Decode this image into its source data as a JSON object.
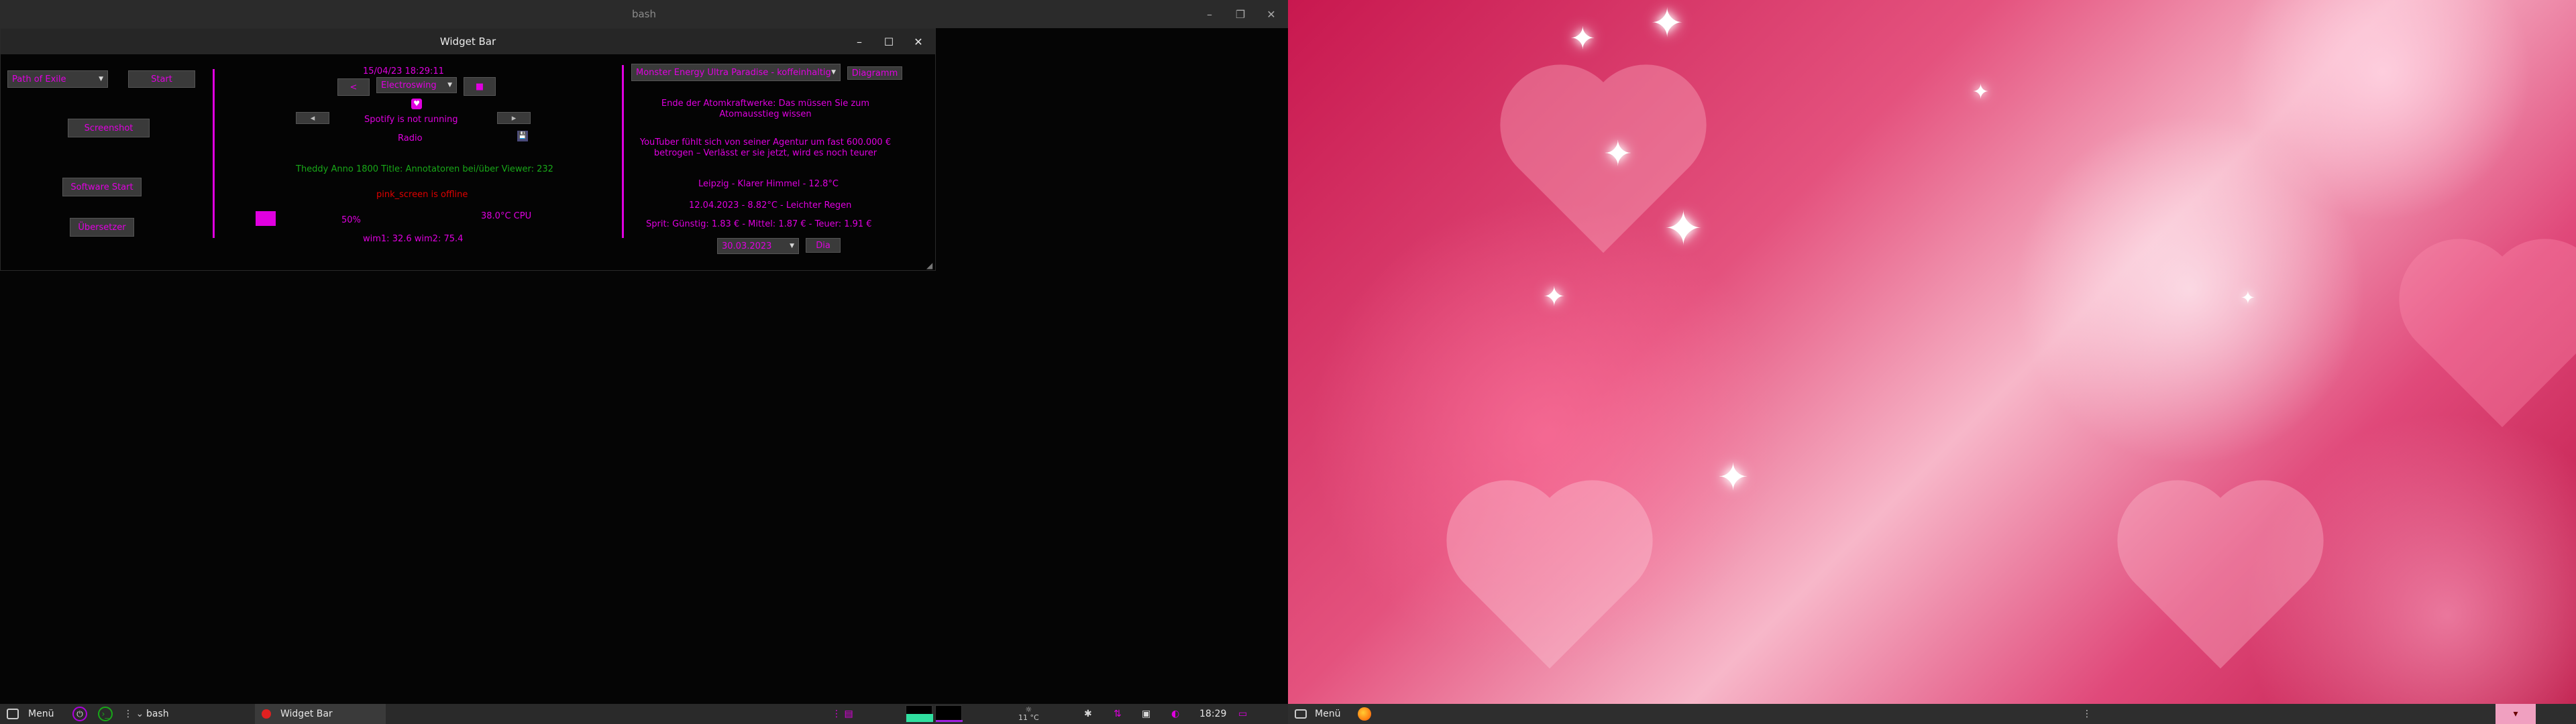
{
  "bash_window": {
    "title": "bash"
  },
  "widget": {
    "title": "Widget Bar",
    "game_select": "Path of Exile",
    "start_label": "Start",
    "screenshot_label": "Screenshot",
    "software_start_label": "Software Start",
    "uebersetzer_label": "Übersetzer",
    "datetime": "15/04/23 18:29:11",
    "prev_label": "<",
    "playlist_select": "Electroswing",
    "stop_label": "■",
    "spotify_status": "Spotify is not running",
    "radio_label": "Radio",
    "twitch_line": "Theddy Anno 1800 Title: Annotatoren bei/über Viewer: 232",
    "stream_status": "pink_screen is offline",
    "volume_percent": "50%",
    "cpu_temp": "38.0°C CPU",
    "wind_status": "wim1: 32.6 wim2: 75.4",
    "product_select": "Monster Energy Ultra Paradise - koffeinhaltig",
    "diagramm_label": "Diagramm",
    "news_1": "Ende der Atomkraftwerke: Das müssen Sie zum Atomausstieg wissen",
    "news_2": "YouTuber fühlt sich von seiner Agentur um fast 600.000 € betrogen – Verlässt er sie jetzt, wird es noch teurer",
    "weather_1": "Leipzig - Klarer Himmel - 12.8°C",
    "weather_2": "12.04.2023 - 8.82°C - Leichter Regen",
    "fuel": "Sprit: Günstig: 1.83 € - Mittel: 1.87 € - Teuer: 1.91 €",
    "date_select": "30.03.2023",
    "dia_label": "Dia"
  },
  "taskbar_left": {
    "menu_label": "Menü",
    "bash_label": "bash",
    "widget_label": "Widget Bar",
    "temperature": "11 °C",
    "clock": "18:29"
  },
  "taskbar_right": {
    "menu_label": "Menü"
  },
  "colors": {
    "accent": "#e000e0",
    "status_green": "#18a818",
    "status_red": "#e00000"
  }
}
